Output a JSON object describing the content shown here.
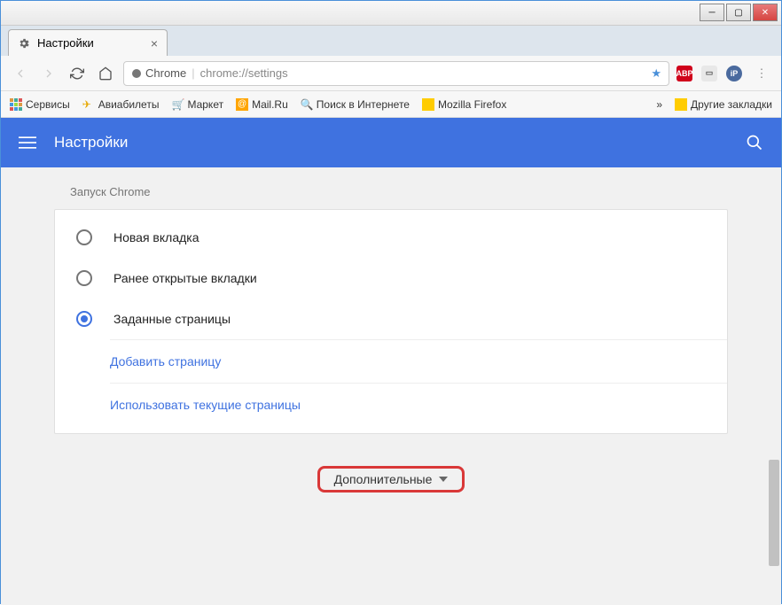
{
  "tab": {
    "title": "Настройки"
  },
  "omnibox": {
    "scheme_label": "Chrome",
    "url": "chrome://settings"
  },
  "bookmarks": {
    "services": "Сервисы",
    "avia": "Авиабилеты",
    "market": "Маркет",
    "mailru": "Mail.Ru",
    "search": "Поиск в Интернете",
    "firefox": "Mozilla Firefox",
    "more": "»",
    "other": "Другие закладки"
  },
  "settings": {
    "header_title": "Настройки",
    "section_title": "Запуск Chrome",
    "options": {
      "new_tab": "Новая вкладка",
      "continue": "Ранее открытые вкладки",
      "specific": "Заданные страницы"
    },
    "links": {
      "add_page": "Добавить страницу",
      "use_current": "Использовать текущие страницы"
    },
    "advanced": "Дополнительные"
  }
}
